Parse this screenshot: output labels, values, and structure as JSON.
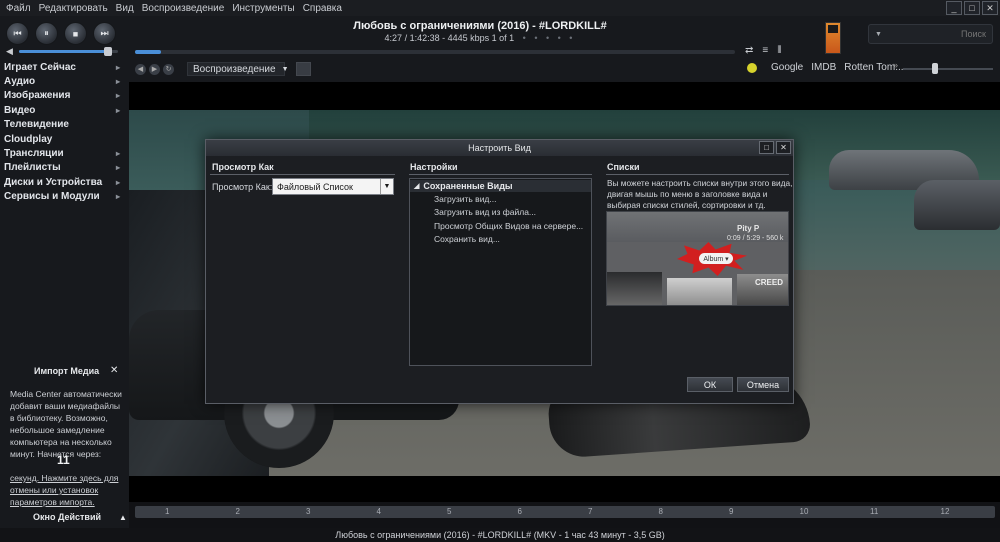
{
  "menu": [
    "Файл",
    "Редактировать",
    "Вид",
    "Воспроизведение",
    "Инструменты",
    "Справка"
  ],
  "window_controls": [
    "_",
    "□",
    "✕"
  ],
  "transport": {
    "prev": "⏮",
    "pause": "⏸",
    "stop": "■",
    "next": "⏭"
  },
  "volume": {
    "icon": "speaker-icon",
    "level": 0.9
  },
  "now_playing": {
    "title": "Любовь с ограничениями (2016) - #LORDKILL#",
    "info": "4:27 / 1:42:38 - 4445 kbps   1 of 1",
    "dots": "• • • • •",
    "progress": 0.043
  },
  "view_controls": [
    "⇄",
    "≡",
    "⦀"
  ],
  "search": {
    "placeholder": "Поиск",
    "arrow": "▼"
  },
  "toolbar": {
    "playback_label": "Воспроизведение",
    "playback_arrow": "▼",
    "back": "◀",
    "fwd": "▶",
    "refresh": "↻"
  },
  "links": [
    "Google",
    "IMDB",
    "Rotten Tom..."
  ],
  "zoom": {
    "level": 0.35
  },
  "sidebar": {
    "items": [
      {
        "label": "Играет Сейчас",
        "arrow": "▸"
      },
      {
        "label": "Аудио",
        "arrow": "▸"
      },
      {
        "label": "Изображения",
        "arrow": "▸"
      },
      {
        "label": "Видео",
        "arrow": "▸"
      },
      {
        "label": "Телевидение",
        "arrow": ""
      },
      {
        "label": "Cloudplay",
        "arrow": ""
      },
      {
        "label": "Трансляции",
        "arrow": "▸"
      },
      {
        "label": "Плейлисты",
        "arrow": "▸"
      },
      {
        "label": "Диски и Устройства",
        "arrow": "▸"
      },
      {
        "label": "Сервисы и Модули",
        "arrow": "▸"
      }
    ]
  },
  "import_panel": {
    "title": "Импорт Медиа",
    "close": "✕",
    "text": "Media Center автоматически добавит ваши медиафайлы в библиотеку. Возможно, небольшое замедление компьютера на несколько минут. Начнется через:",
    "countdown": "11",
    "link": "секунд. Нажмите здесь для отмены или установок параметров импорта."
  },
  "actions_panel": {
    "title": "Окно Действий",
    "arrow": "▲"
  },
  "timeline": {
    "labels": [
      "1",
      "2",
      "3",
      "4",
      "5",
      "6",
      "7",
      "8",
      "9",
      "10",
      "11",
      "12"
    ]
  },
  "status_bar": "Любовь с ограничениями (2016) - #LORDKILL# (MKV - 1 час 43 минут - 3,5 GB)",
  "dialog": {
    "title": "Настроить Вид",
    "controls": [
      "□",
      "✕"
    ],
    "view_as": {
      "header": "Просмотр Как",
      "label": "Просмотр Как:",
      "value": "Файловый Список",
      "arrow": "▼"
    },
    "settings": {
      "header": "Настройки",
      "group": "Сохраненные Виды",
      "group_arrow": "◢",
      "items": [
        "Загрузить вид...",
        "Загрузить вид из файла...",
        "Просмотр Общих Видов на сервере...",
        "Сохранить вид..."
      ]
    },
    "lists": {
      "header": "Списки",
      "text": "Вы можете настроить списки внутри этого вида, двигая мышь по меню в заголовке вида и выбирая списки стилей, сортировки и тд.",
      "preview_title": "Pity P",
      "preview_time": "0:09 / 5:29 - 560 k",
      "preview_pill": "Album ▾",
      "preview_creed": "CREED"
    },
    "ok": "ОК",
    "cancel": "Отмена"
  }
}
